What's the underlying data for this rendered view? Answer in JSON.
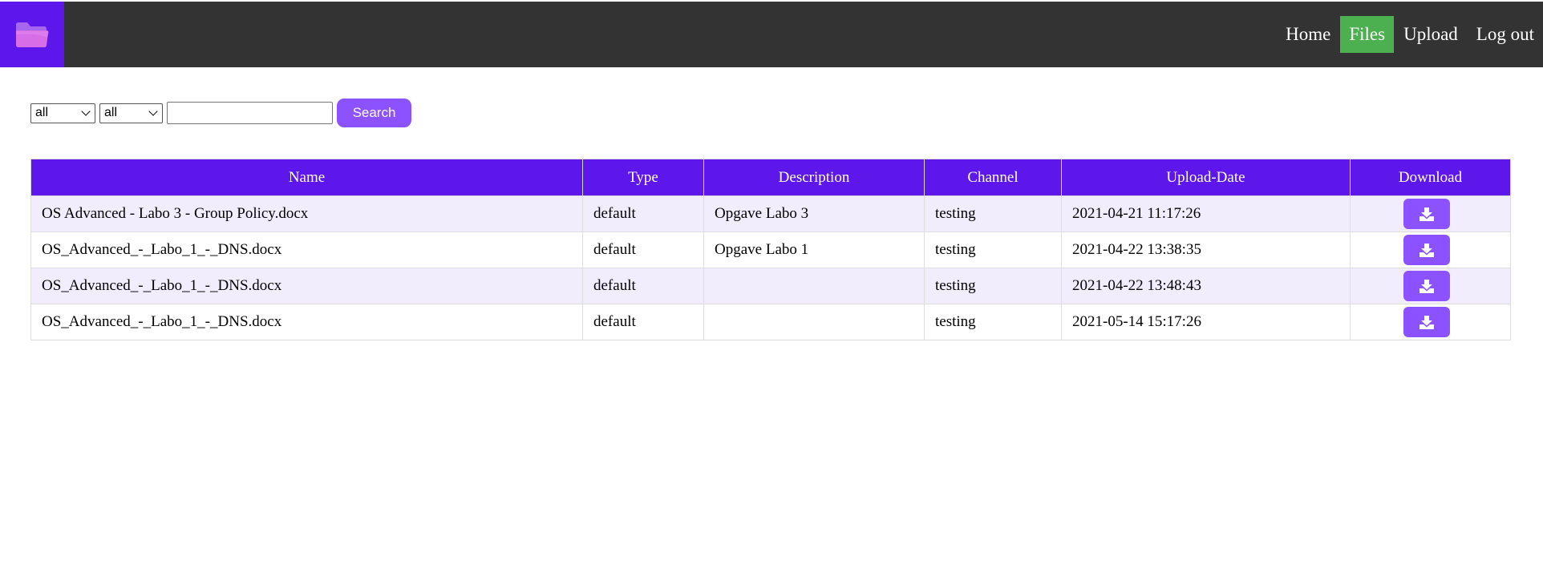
{
  "nav": {
    "logo_icon": "folder-icon",
    "links": [
      {
        "label": "Home",
        "active": false
      },
      {
        "label": "Files",
        "active": true
      },
      {
        "label": "Upload",
        "active": false
      },
      {
        "label": "Log out",
        "active": false
      }
    ]
  },
  "search": {
    "filter1_value": "all",
    "filter2_value": "all",
    "query_value": "",
    "button_label": "Search"
  },
  "table": {
    "headers": [
      "Name",
      "Type",
      "Description",
      "Channel",
      "Upload-Date",
      "Download"
    ],
    "rows": [
      {
        "name": "OS Advanced - Labo 3 - Group Policy.docx",
        "type": "default",
        "description": "Opgave Labo 3",
        "channel": "testing",
        "date": "2021-04-21 11:17:26"
      },
      {
        "name": "OS_Advanced_-_Labo_1_-_DNS.docx",
        "type": "default",
        "description": "Opgave Labo 1",
        "channel": "testing",
        "date": "2021-04-22 13:38:35"
      },
      {
        "name": "OS_Advanced_-_Labo_1_-_DNS.docx",
        "type": "default",
        "description": "",
        "channel": "testing",
        "date": "2021-04-22 13:48:43"
      },
      {
        "name": "OS_Advanced_-_Labo_1_-_DNS.docx",
        "type": "default",
        "description": "",
        "channel": "testing",
        "date": "2021-05-14 15:17:26"
      }
    ],
    "download_icon": "download-icon"
  },
  "colors": {
    "navbar": "#333333",
    "logo_bg": "#5e17eb",
    "active_link": "#4caf50",
    "header_bg": "#5e17eb",
    "button": "#8c52ff",
    "row_stripe": "#f1edfd"
  }
}
